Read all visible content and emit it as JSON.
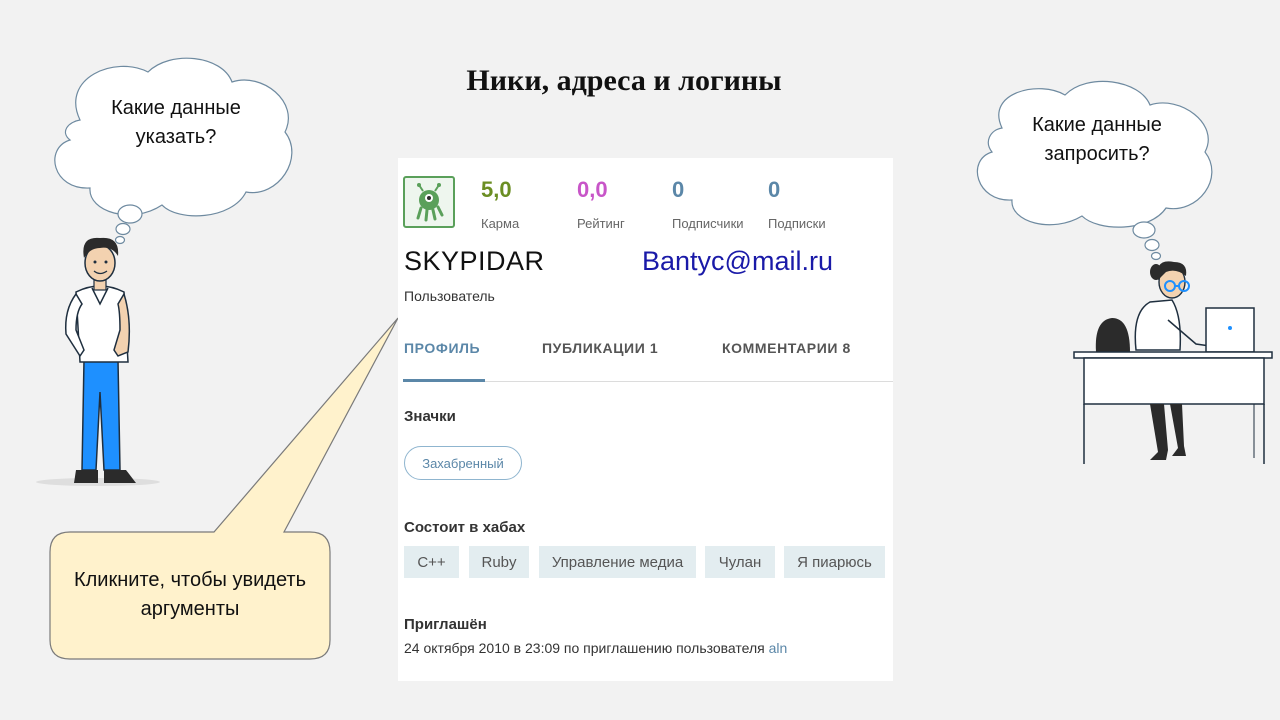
{
  "slide": {
    "title": "Ники, адреса и логины",
    "left_thought": "Какие данные указать?",
    "right_thought": "Какие данные запросить?",
    "callout": "Кликните, чтобы увидеть аргументы"
  },
  "profile": {
    "stats": [
      {
        "value": "5,0",
        "label": "Карма",
        "color": "#6b8e23"
      },
      {
        "value": "0,0",
        "label": "Рейтинг",
        "color": "#c855c8"
      },
      {
        "value": "0",
        "label": "Подписчики",
        "color": "#5b87a8"
      },
      {
        "value": "0",
        "label": "Подписки",
        "color": "#5b87a8"
      }
    ],
    "nickname": "SKYPIDAR",
    "email": "Bantyc@mail.ru",
    "role": "Пользователь",
    "tabs": [
      {
        "label": "ПРОФИЛЬ",
        "active": true
      },
      {
        "label": "ПУБЛИКАЦИИ 1",
        "active": false
      },
      {
        "label": "КОММЕНТАРИИ 8",
        "active": false
      }
    ],
    "badges_title": "Значки",
    "badges": [
      "Захабренный"
    ],
    "hubs_title": "Состоит в хабах",
    "hubs": [
      "C++",
      "Ruby",
      "Управление медиа",
      "Чулан",
      "Я пиарюсь"
    ],
    "invited_title": "Приглашён",
    "invited_text": "24 октября 2010 в 23:09 по приглашению пользователя",
    "invited_by": "aln"
  },
  "colors": {
    "accent": "#5b87a8",
    "email": "#1a1aa8",
    "callout_fill": "#fff2cc"
  }
}
